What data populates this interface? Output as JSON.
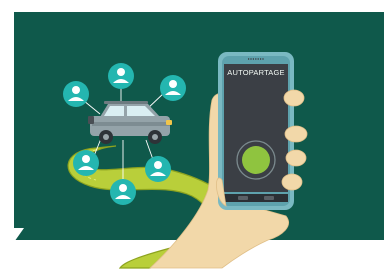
{
  "phone": {
    "app_title": "AUTOPARTAGE"
  },
  "icons": {
    "user_icons": [
      "user-icon-top-left",
      "user-icon-top-center",
      "user-icon-top-right",
      "user-icon-left",
      "user-icon-bottom-center",
      "user-icon-right"
    ],
    "vehicle": "suv-car-icon",
    "hand": "hand-holding-phone",
    "action_button": "circle-button-icon"
  },
  "colors": {
    "background": "#0f594b",
    "user_icon_fill": "#24b6b0",
    "road": "#b9cf3a",
    "road_edge": "#8da31f",
    "car_body": "#94a3a9",
    "phone_body": "#7ab9c2",
    "phone_screen": "#3b3f45",
    "phone_button": "#8fc43f",
    "hand": "#f2d8a9"
  }
}
